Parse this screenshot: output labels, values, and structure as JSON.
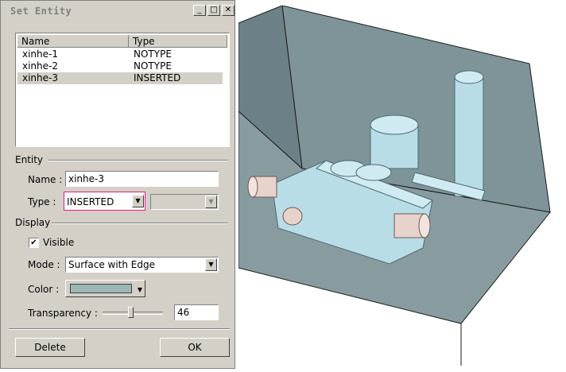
{
  "dialog": {
    "title": "Set Entity",
    "titlebar_buttons": {
      "minimize": "_",
      "maximize": "□",
      "close": "✕"
    },
    "list": {
      "columns": [
        "Name",
        "Type"
      ],
      "rows": [
        {
          "name": "xinhe-1",
          "type": "NOTYPE",
          "selected": false
        },
        {
          "name": "xinhe-2",
          "type": "NOTYPE",
          "selected": false
        },
        {
          "name": "xinhe-3",
          "type": "INSERTED",
          "selected": true
        }
      ]
    },
    "entity": {
      "section_label": "Entity",
      "name_label": "Name :",
      "name_value": "xinhe-3",
      "type_label": "Type :",
      "type_value": "INSERTED",
      "subtype_value": ""
    },
    "display": {
      "section_label": "Display",
      "visible_label": "Visible",
      "visible_checked": true,
      "mode_label": "Mode :",
      "mode_value": "Surface with Edge",
      "color_label": "Color :",
      "color_swatch": "#9ab7b3",
      "transparency_label": "Transparency :",
      "transparency_value": "46",
      "transparency_level_pct": 46
    },
    "buttons": {
      "delete": "Delete",
      "ok": "OK"
    }
  },
  "colors": {
    "dialog_bg": "#d4d0c8",
    "type_highlight": "#e0207a",
    "box_face": "#758a90",
    "part_color": "#b8dde6",
    "pin_color": "#e8d2cc"
  }
}
